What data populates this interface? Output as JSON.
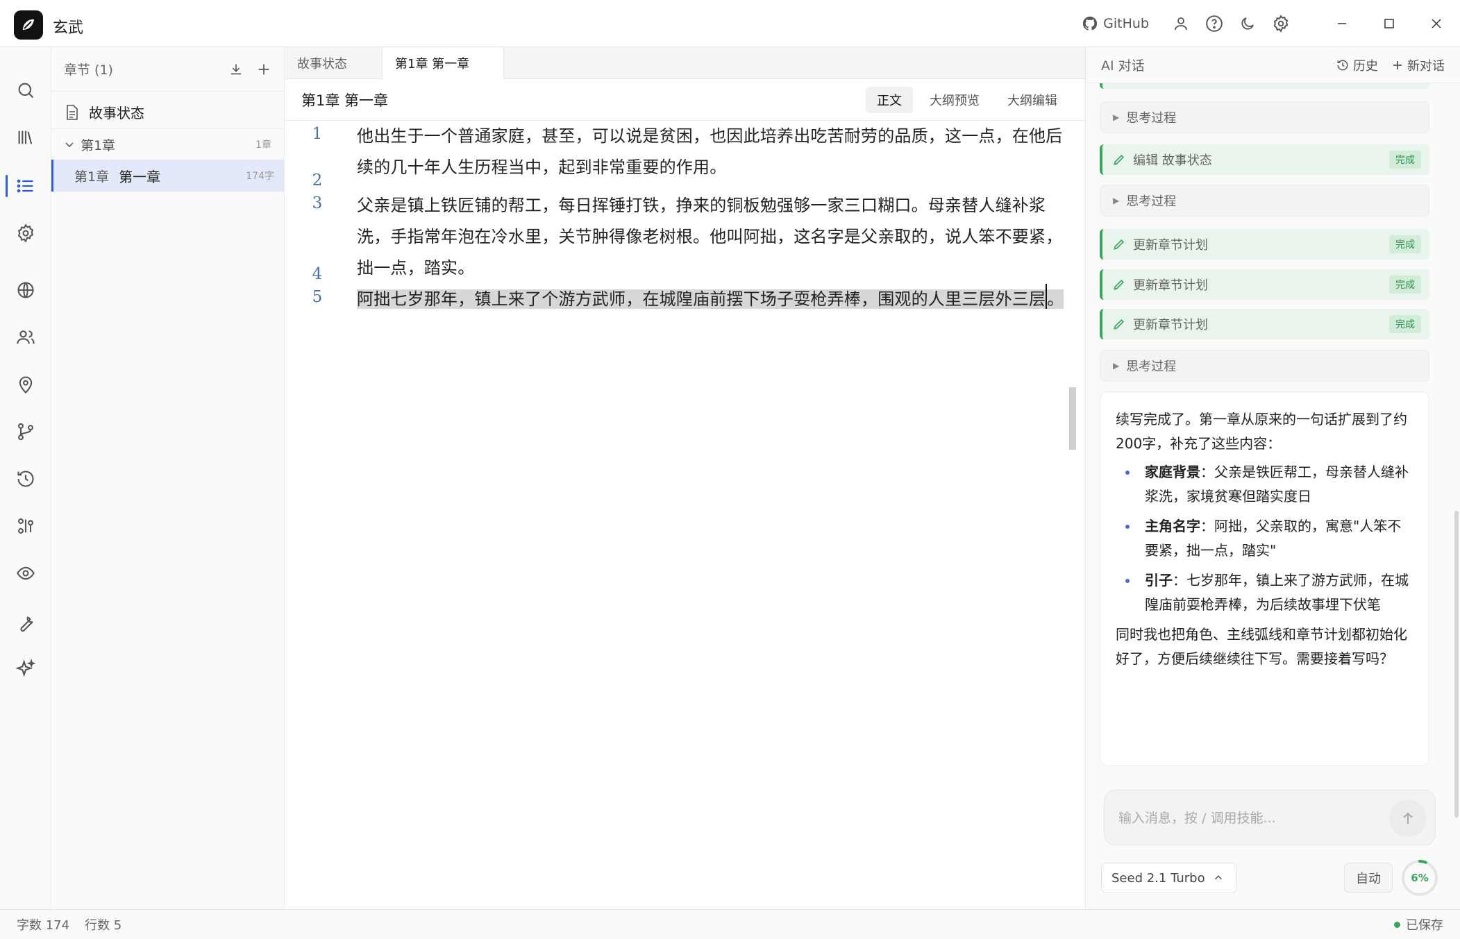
{
  "app": {
    "title": "玄武"
  },
  "titlebar": {
    "github_label": "GitHub"
  },
  "chapters": {
    "header": "章节 (1)",
    "story_status": "故事状态",
    "volume": {
      "label": "第1章",
      "count": "1章"
    },
    "chapter": {
      "num": "第1章",
      "name": "第一章",
      "count": "174字"
    }
  },
  "editor": {
    "tabs": [
      "故事状态",
      "第1章 第一章"
    ],
    "title": "第1章 第一章",
    "view_tabs": [
      "正文",
      "大纲预览",
      "大纲编辑"
    ],
    "lines": [
      {
        "num": "1",
        "text": "他出生于一个普通家庭，甚至，可以说是贫困，也因此培养出吃苦耐劳的品质，这一点，在他后续的几十年人生历程当中，起到非常重要的作用。"
      },
      {
        "num": "2",
        "text": ""
      },
      {
        "num": "3",
        "text": "父亲是镇上铁匠铺的帮工，每日挥锤打铁，挣来的铜板勉强够一家三口糊口。母亲替人缝补浆洗，手指常年泡在冷水里，关节肿得像老树根。他叫阿拙，这名字是父亲取的，说人笨不要紧，拙一点，踏实。"
      },
      {
        "num": "4",
        "text": ""
      },
      {
        "num": "5",
        "text_a": "阿拙七岁那年，镇上来了个游方武师，在城隍庙前摆下场子耍枪弄棒，围观的人里三层外三",
        "text_b": "层",
        "text_c": "。"
      }
    ]
  },
  "ai": {
    "title": "AI 对话",
    "history": "历史",
    "new_chat": "新对话",
    "thinking": "思考过程",
    "tools": [
      {
        "label": "编辑 故事状态",
        "status": "完成"
      },
      {
        "label": "更新章节计划",
        "status": "完成"
      },
      {
        "label": "更新章节计划",
        "status": "完成"
      },
      {
        "label": "更新章节计划",
        "status": "完成"
      }
    ],
    "message": {
      "intro": "续写完成了。第一章从原来的一句话扩展到了约200字，补充了这些内容：",
      "bullets": [
        {
          "key": "家庭背景",
          "text": "：父亲是铁匠帮工，母亲替人缝补浆洗，家境贫寒但踏实度日"
        },
        {
          "key": "主角名字",
          "text": "：阿拙，父亲取的，寓意\"人笨不要紧，拙一点，踏实\""
        },
        {
          "key": "引子",
          "text": "：七岁那年，镇上来了游方武师，在城隍庙前耍枪弄棒，为后续故事埋下伏笔"
        }
      ],
      "outro": "同时我也把角色、主线弧线和章节计划都初始化好了，方便后续继续往下写。需要接着写吗？"
    },
    "input_placeholder": "输入消息，按 / 调用技能...",
    "model": "Seed 2.1 Turbo",
    "auto": "自动",
    "context_usage": "6%",
    "context_fraction": 0.06
  },
  "status": {
    "words": "字数 174",
    "lines": "行数 5",
    "saved": "已保存"
  },
  "colors": {
    "accent": "#2f5bd6",
    "success": "#3aa55c"
  }
}
